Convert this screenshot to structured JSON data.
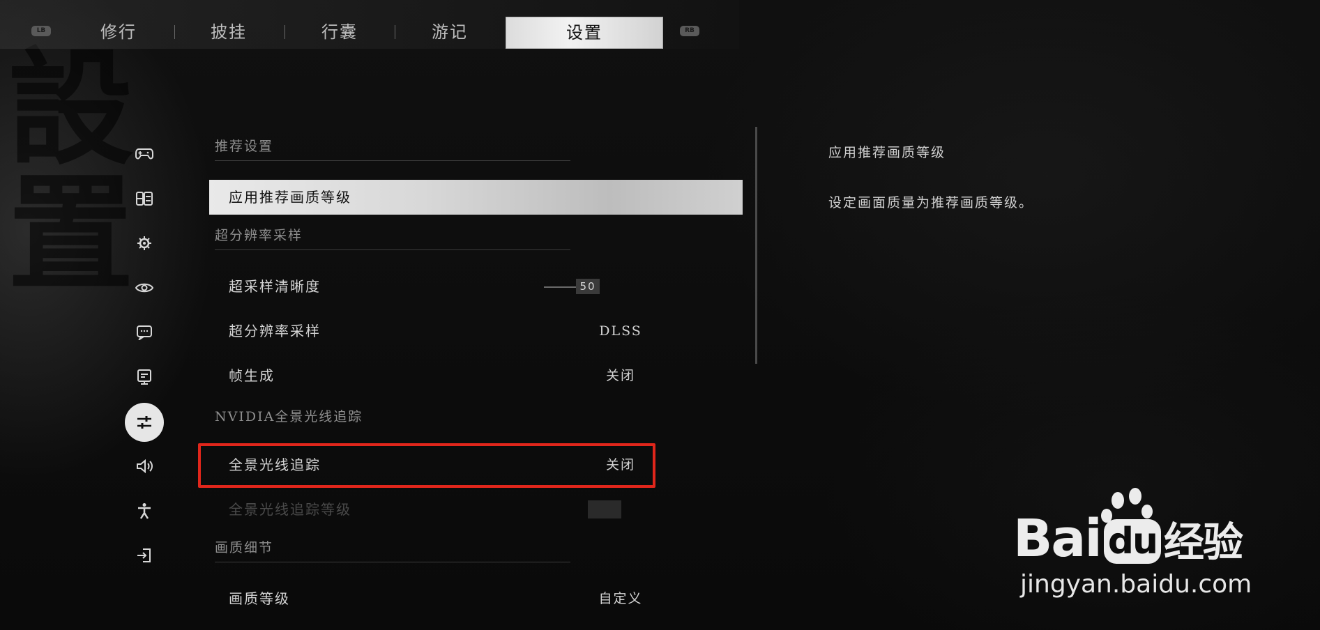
{
  "nav": {
    "left_bumper": "LB",
    "right_bumper": "RB",
    "tabs": [
      {
        "label": "修行"
      },
      {
        "label": "披挂"
      },
      {
        "label": "行囊"
      },
      {
        "label": "游记"
      },
      {
        "label": "设置"
      }
    ],
    "active_tab": "设置"
  },
  "rail": {
    "icons": [
      "gamepad-icon",
      "layout-icon",
      "gear-icon",
      "eye-icon",
      "chat-screen-icon",
      "monitor-icon",
      "sliders-icon",
      "speaker-icon",
      "accessibility-icon",
      "exit-icon"
    ],
    "active": "sliders-icon"
  },
  "settings": {
    "sec_recommended": "推荐设置",
    "row_apply_recommended": "应用推荐画质等级",
    "sec_super_res": "超分辨率采样",
    "row_sharpness": "超采样清晰度",
    "row_sharpness_value": "50",
    "row_super_res": "超分辨率采样",
    "row_super_res_value": "DLSS",
    "row_frame_gen": "帧生成",
    "row_frame_gen_value": "关闭",
    "sec_nvidia": "NVIDIA全景光线追踪",
    "row_path_tracing": "全景光线追踪",
    "row_path_tracing_value": "关闭",
    "row_path_tracing_level": "全景光线追踪等级",
    "sec_quality": "画质细节",
    "row_quality_level": "画质等级",
    "row_quality_level_value": "自定义"
  },
  "description": {
    "title": "应用推荐画质等级",
    "text": "设定画面质量为推荐画质等级。"
  },
  "watermark": {
    "brand_left": "Bai",
    "brand_du": "du",
    "brand_cn": "经验",
    "url": "jingyan.baidu.com"
  },
  "colors": {
    "highlight_frame": "#e0261b",
    "selected_row": "#d8d8d8"
  }
}
